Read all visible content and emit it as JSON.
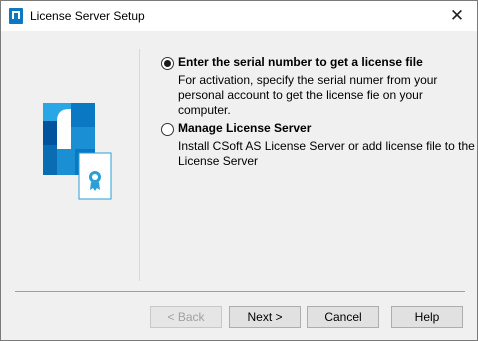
{
  "window": {
    "title": "License Server Setup",
    "close_glyph": "✕"
  },
  "options": [
    {
      "title": "Enter the serial number to get a license file",
      "description": "For activation, specify the serial numer from your personal account to get the license fie on your computer.",
      "selected": true
    },
    {
      "title": "Manage License Server",
      "description": "Install CSoft AS License Server or add license file to the License Server",
      "selected": false
    }
  ],
  "buttons": {
    "back": "< Back",
    "next": "Next >",
    "cancel": "Cancel",
    "help": "Help"
  },
  "colors": {
    "accent_blue": "#0a78c2",
    "light_blue": "#29a6e6",
    "dark_blue": "#00539c",
    "seal_blue": "#2a9fd6"
  },
  "icons": {
    "title_icon": "license-app-icon",
    "logo": "csoft-logo-icon",
    "certificate": "certificate-icon"
  }
}
